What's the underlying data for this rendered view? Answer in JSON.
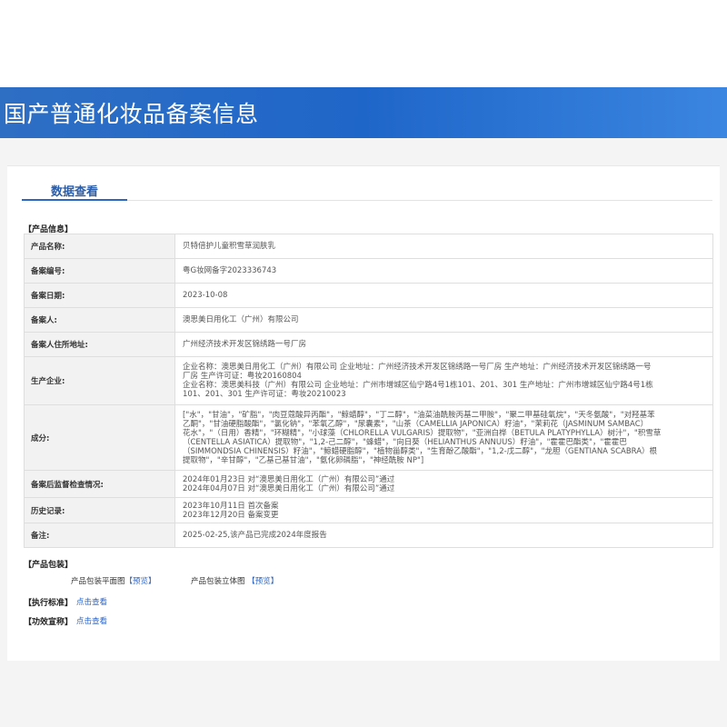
{
  "header": {
    "title": "国产普通化妆品备案信息"
  },
  "tabs": [
    {
      "label": "数据查看"
    }
  ],
  "sections": {
    "product_info": "【产品信息】",
    "packaging": "【产品包装】",
    "standard": "【执行标准】",
    "efficacy": "【功效宣称】"
  },
  "info_rows": [
    {
      "label": "产品名称:",
      "value": "贝特倍护儿童积雪草润肤乳"
    },
    {
      "label": "备案编号:",
      "value": "粤G妆网备字2023336743"
    },
    {
      "label": "备案日期:",
      "value": "2023-10-08"
    },
    {
      "label": "备案人:",
      "value": "澳思美日用化工（广州）有限公司"
    },
    {
      "label": "备案人住所地址:",
      "value": "广州经济技术开发区锦绣路一号厂房"
    },
    {
      "label": "生产企业:",
      "lines": [
        "企业名称：澳思美日用化工（广州）有限公司 企业地址：广州经济技术开发区锦绣路一号厂房 生产地址：广州经济技术开发区锦绣路一号",
        "厂房 生产许可证：粤妆20160804",
        "企业名称：澳思美科技（广州）有限公司 企业地址：广州市增城区仙宁路4号1栋101、201、301 生产地址：广州市增城区仙宁路4号1栋",
        "101、201、301 生产许可证：粤妆20210023"
      ]
    },
    {
      "label": "成分:",
      "lines": [
        "[\"水\"，\"甘油\"，\"矿脂\"，\"肉豆蔻酸异丙酯\"，\"鲸蜡醇\"，\"丁二醇\"，\"油菜油酰胺丙基二甲胺\"，\"聚二甲基硅氧烷\"，\"天冬氨酸\"，\"对羟基苯",
        "乙酮\"，\"甘油硬脂酸酯\"，\"氯化钠\"，\"苯氧乙醇\"，\"尿囊素\"，\"山茶（CAMELLIA JAPONICA）籽油\"，\"茉莉花（JASMINUM SAMBAC）",
        "花水\"，\"（日用）香精\"，\"环糊精\"，\"小球藻（CHLORELLA VULGARIS）提取物\"，\"亚洲白桦（BETULA PLATYPHYLLA）树汁\"，\"积雪草",
        "（CENTELLA ASIATICA）提取物\"，\"1,2-己二醇\"，\"蜂蜡\"，\"向日葵（HELIANTHUS ANNUUS）籽油\"，\"霍霍巴酯类\"，\"霍霍巴",
        "（SIMMONDSIA CHINENSIS）籽油\"，\"鲸蜡硬脂醇\"，\"植物甾醇类\"，\"生育酚乙酸酯\"，\"1,2-戊二醇\"，\"龙胆（GENTIANA SCABRA）根",
        "提取物\"，\"辛甘醇\"，\"乙基己基甘油\"，\"氨化卵磷脂\"，\"神经酰胺 NP\"]"
      ]
    },
    {
      "label": "备案后监督检查情况:",
      "lines": [
        "2024年01月23日 对“澳思美日用化工（广州）有限公司”通过",
        "2024年04月07日 对“澳思美日用化工（广州）有限公司”通过"
      ]
    },
    {
      "label": "历史记录:",
      "lines": [
        "2023年10月11日 首次备案",
        "2023年12月20日 备案变更"
      ]
    },
    {
      "label": "备注:",
      "value": "2025-02-25,该产品已完成2024年度报告"
    }
  ],
  "packaging": {
    "flat_label": "产品包装平面图",
    "flat_link": "【预览】",
    "solid_label": "产品包装立体图",
    "solid_link": "【预览】"
  },
  "view_link": "点击查看",
  "colors": {
    "banner": "#1f66c9",
    "link": "#2b63c4",
    "label_bg": "#f2f2f2"
  }
}
